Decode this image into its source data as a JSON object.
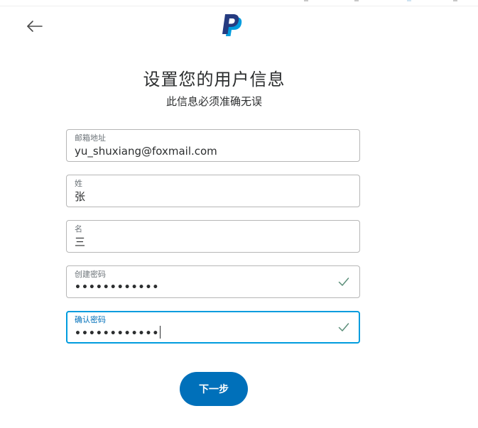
{
  "header": {
    "back_icon": "arrow-left-icon",
    "logo_icon": "paypal-logo-icon"
  },
  "page": {
    "title": "设置您的用户信息",
    "subtitle": "此信息必须准确无误"
  },
  "form": {
    "email": {
      "label": "邮箱地址",
      "value": "yu_shuxiang@foxmail.com"
    },
    "last_name": {
      "label": "姓",
      "value": "张"
    },
    "first_name": {
      "label": "名",
      "value": "三"
    },
    "create_password": {
      "label": "创建密码",
      "value": "••••••••••••",
      "valid_icon": "check-icon"
    },
    "confirm_password": {
      "label": "确认密码",
      "value": "••••••••••••",
      "valid_icon": "check-icon"
    }
  },
  "actions": {
    "next_label": "下一步"
  },
  "colors": {
    "primary": "#0070ba",
    "focus_border": "#009cde",
    "check": "#5c8f7a",
    "text": "#2c2e2f",
    "label": "#6c7378",
    "border": "#b6b6b6"
  }
}
